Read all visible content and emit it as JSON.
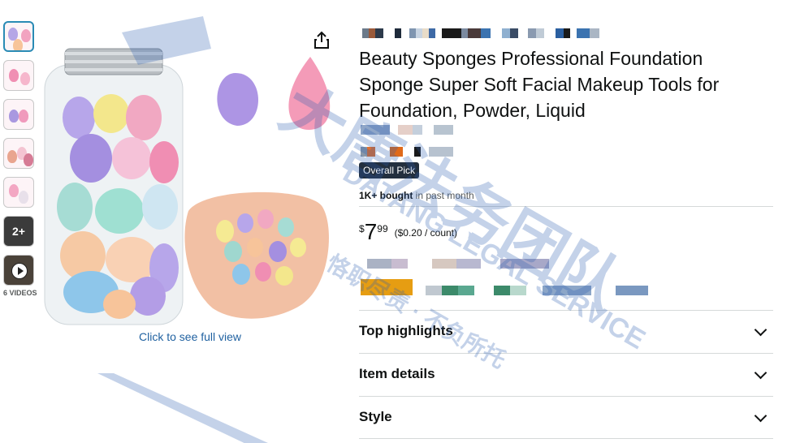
{
  "gallery": {
    "more_count": "2+",
    "videos_label": "6 VIDEOS",
    "see_full_view": "Click to see full view"
  },
  "product": {
    "title": "Beauty Sponges Professional Foundation Sponge Super Soft Facial Makeup Tools for Foundation, Powder, Liquid",
    "badge": "Overall Pick",
    "bought_bold": "1K+ bought",
    "bought_rest": " in past month",
    "price_symbol": "$",
    "price_whole": "7",
    "price_fraction": "99",
    "unit_price": "($0.20 / count)"
  },
  "accordion": [
    {
      "label": "Top highlights"
    },
    {
      "label": "Item details"
    },
    {
      "label": "Style"
    }
  ],
  "watermark": {
    "cn_main": "大唐法务团队",
    "en_main": "DATANG LEGAL SERVICE",
    "cn_sub": "恪职尽责 · 不负所托"
  },
  "icons": {
    "share": "share-icon",
    "chevron": "chevron-down-icon",
    "play": "play-icon"
  }
}
